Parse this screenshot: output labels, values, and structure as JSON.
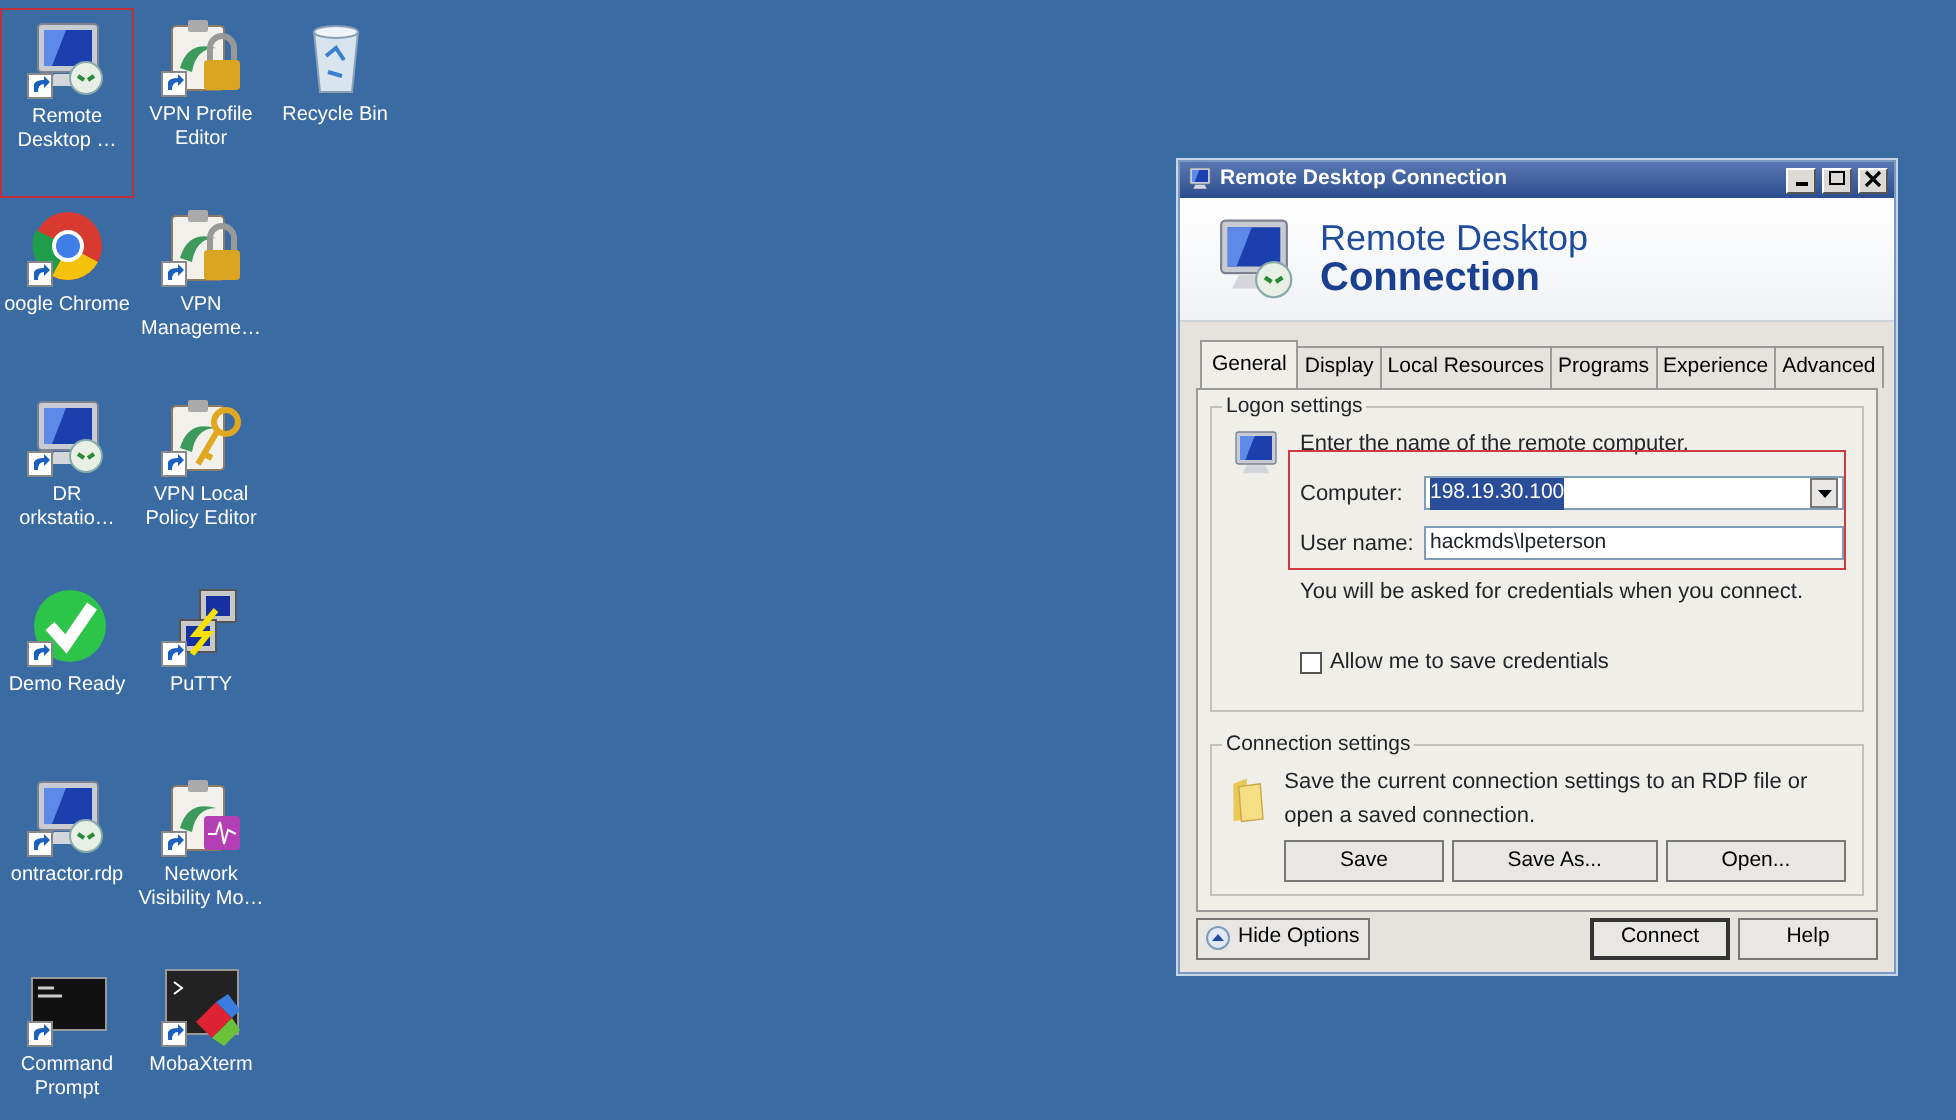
{
  "desktop_columns": [
    [
      {
        "label": "Remote\nDesktop …",
        "kind": "rdp",
        "selected": true
      },
      {
        "label": "oogle Chrome",
        "kind": "chrome",
        "selected": false
      },
      {
        "label": "DR\norkstatio…",
        "kind": "rdp",
        "selected": false
      },
      {
        "label": "Demo Ready",
        "kind": "check",
        "selected": false
      },
      {
        "label": "ontractor.rdp",
        "kind": "rdp",
        "selected": false
      },
      {
        "label": "Command Prompt",
        "kind": "cmd",
        "selected": false
      }
    ],
    [
      {
        "label": "VPN Profile Editor",
        "kind": "vpn-lock",
        "selected": false
      },
      {
        "label": "VPN\nManageme…",
        "kind": "vpn-lock",
        "selected": false
      },
      {
        "label": "VPN Local\nPolicy Editor",
        "kind": "vpn-key",
        "selected": false
      },
      {
        "label": "PuTTY",
        "kind": "putty",
        "selected": false
      },
      {
        "label": "Network\nVisibility Mo…",
        "kind": "vpn-wave",
        "selected": false
      },
      {
        "label": "MobaXterm",
        "kind": "moba",
        "selected": false
      }
    ],
    [
      {
        "label": "Recycle Bin",
        "kind": "bin",
        "selected": false
      }
    ]
  ],
  "dialog": {
    "title": "Remote Desktop Connection",
    "heading_line_1": "Remote Desktop",
    "heading_line_2": "Connection",
    "tabs": [
      {
        "label": "General",
        "selected": true
      },
      {
        "label": "Display",
        "selected": false
      },
      {
        "label": "Local Resources",
        "selected": false
      },
      {
        "label": "Programs",
        "selected": false
      },
      {
        "label": "Experience",
        "selected": false
      },
      {
        "label": "Advanced",
        "selected": false
      }
    ],
    "logon": {
      "legend": "Logon settings",
      "prompt": "Enter the name of the remote computer.",
      "highlighted": true,
      "computer_label": "Computer:",
      "computer_value": "198.19.30.100",
      "computer_text_selected": true,
      "user_label": "User name:",
      "user_value": "hackmds\\lpeterson",
      "note": "You will be asked for credentials when you connect.",
      "save_credentials": {
        "label": "Allow me to save credentials",
        "checked": false
      }
    },
    "connection": {
      "legend": "Connection settings",
      "text": "Save the current connection settings to an RDP file or open a saved connection.",
      "buttons": [
        "Save",
        "Save As...",
        "Open..."
      ]
    },
    "hide_options": "Hide Options",
    "buttons": [
      {
        "label": "Connect",
        "default": true
      },
      {
        "label": "Help",
        "default": false
      }
    ]
  }
}
